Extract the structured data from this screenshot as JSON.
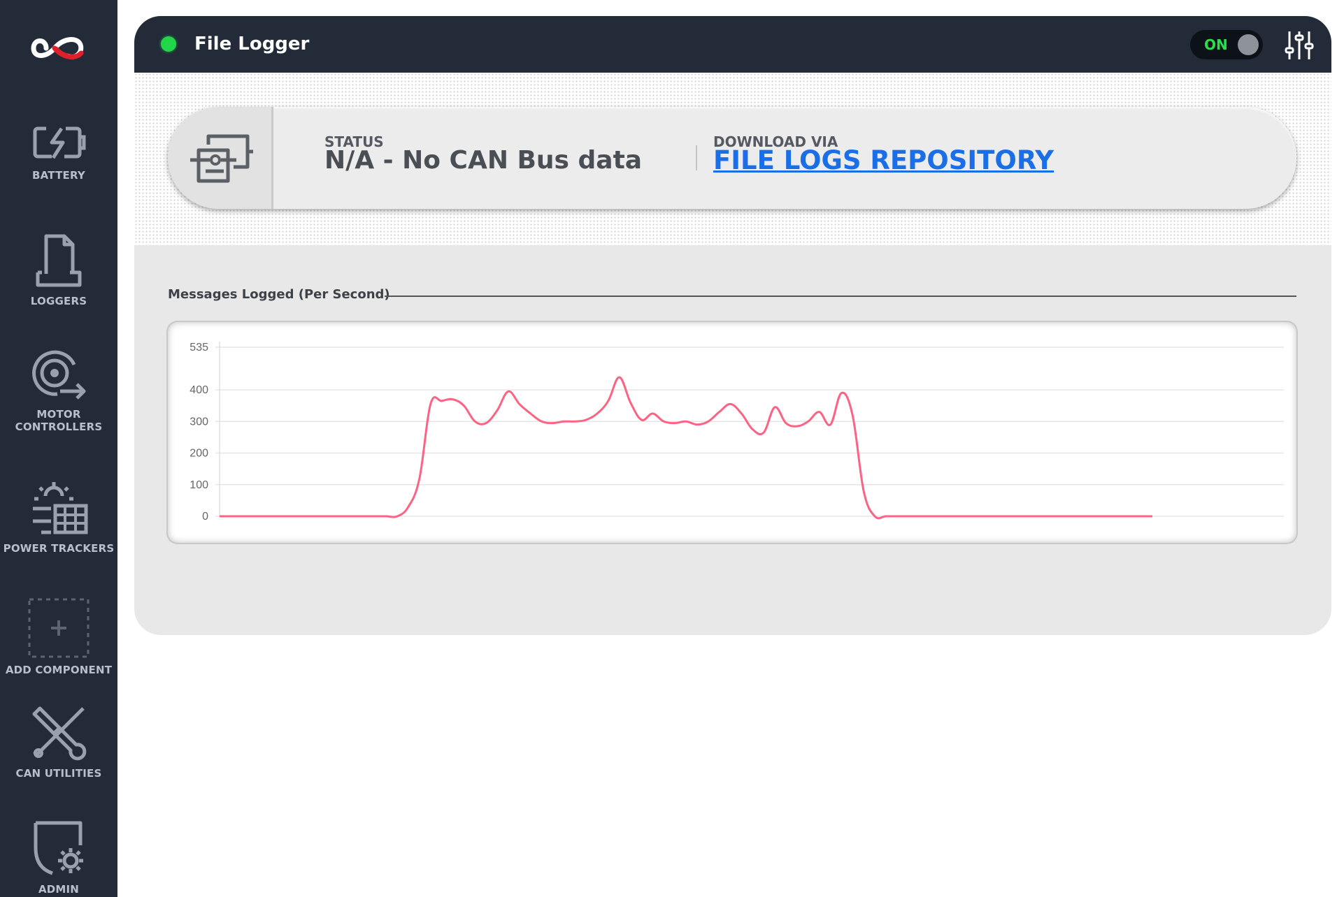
{
  "app": {
    "title": "File Logger"
  },
  "toggle": {
    "label": "ON",
    "state": "on"
  },
  "sidebar": {
    "items": [
      {
        "label": "BATTERY",
        "icon": "battery-icon"
      },
      {
        "label": "LOGGERS",
        "icon": "logger-file-icon"
      },
      {
        "label": "MOTOR",
        "label2": "CONTROLLERS",
        "icon": "motor-icon"
      },
      {
        "label": "POWER TRACKERS",
        "icon": "solar-panel-icon"
      },
      {
        "label": "ADD COMPONENT",
        "icon": "add-component-icon"
      },
      {
        "label": "CAN UTILITIES",
        "icon": "tools-icon"
      },
      {
        "label": "ADMIN",
        "icon": "admin-settings-icon"
      }
    ]
  },
  "status": {
    "caption": "STATUS",
    "value": "N/A - No CAN Bus data",
    "download_caption": "DOWNLOAD VIA",
    "download_link": "FILE LOGS REPOSITORY"
  },
  "chart_section": {
    "title": "Messages Logged (Per Second)"
  },
  "colors": {
    "sidebar_bg": "#232b39",
    "status_dot": "#22d64a",
    "toggle_text": "#27e04a",
    "link": "#1a6ee8",
    "series_line": "#ff6384"
  },
  "chart_data": {
    "type": "line",
    "title": "",
    "xlabel": "",
    "ylabel": "",
    "ylim": [
      0,
      535
    ],
    "yticks": [
      0,
      100,
      200,
      300,
      400,
      535
    ],
    "grid": true,
    "legend": "none",
    "series": [
      {
        "values": [
          0,
          0,
          0,
          0,
          0,
          0,
          0,
          0,
          0,
          0,
          0,
          0,
          0,
          0,
          0,
          0,
          0,
          30,
          120,
          355,
          365,
          370,
          350,
          300,
          295,
          335,
          395,
          355,
          325,
          300,
          295,
          300,
          300,
          305,
          325,
          365,
          440,
          360,
          305,
          325,
          300,
          295,
          300,
          290,
          300,
          330,
          355,
          325,
          275,
          265,
          345,
          295,
          285,
          300,
          330,
          290,
          390,
          320,
          80,
          0,
          0,
          0,
          0,
          0,
          0,
          0,
          0,
          0,
          0,
          0,
          0,
          0,
          0,
          0,
          0,
          0,
          0,
          0,
          0,
          0,
          0,
          0,
          0,
          0,
          0
        ]
      }
    ]
  }
}
